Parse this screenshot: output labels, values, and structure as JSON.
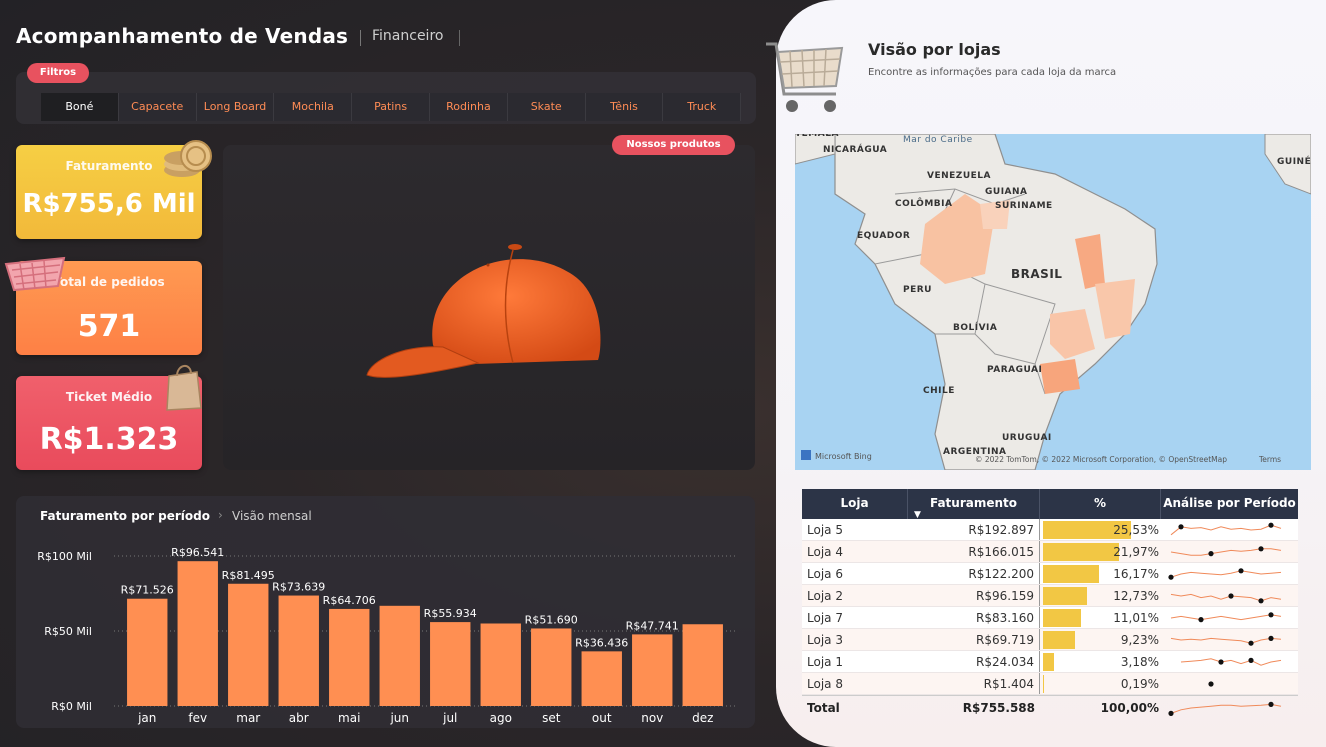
{
  "header": {
    "title": "Acompanhamento de Vendas",
    "subtitle": "Financeiro"
  },
  "filters": {
    "label": "Filtros",
    "tabs": [
      "Boné",
      "Capacete",
      "Long Board",
      "Mochila",
      "Patins",
      "Rodinha",
      "Skate",
      "Tênis",
      "Truck"
    ],
    "active": 0
  },
  "kpis": {
    "faturamento": {
      "label": "Faturamento",
      "value": "R$755,6 Mil"
    },
    "pedidos": {
      "label": "Total de pedidos",
      "value": "571"
    },
    "ticket": {
      "label": "Ticket Médio",
      "value": "R$1.323"
    }
  },
  "product": {
    "badge": "Nossos produtos",
    "icon": "orange-cap"
  },
  "chart_section": {
    "title": "Faturamento por período",
    "subtitle": "Visão mensal"
  },
  "chart_data": {
    "type": "bar",
    "categories": [
      "jan",
      "fev",
      "mar",
      "abr",
      "mai",
      "jun",
      "jul",
      "ago",
      "set",
      "out",
      "nov",
      "dez"
    ],
    "values": [
      71526,
      96541,
      81495,
      73639,
      64706,
      66800,
      55934,
      55000,
      51690,
      36436,
      47741,
      54500
    ],
    "labels": [
      "R$71.526",
      "R$96.541",
      "R$81.495",
      "R$73.639",
      "R$64.706",
      "",
      "R$55.934",
      "",
      "R$51.690",
      "R$36.436",
      "R$47.741",
      ""
    ],
    "ylim": [
      0,
      100000
    ],
    "yticks": [
      {
        "v": 0,
        "t": "R$0 Mil"
      },
      {
        "v": 50000,
        "t": "R$50 Mil"
      },
      {
        "v": 100000,
        "t": "R$100 Mil"
      }
    ],
    "color": "#ff8f52"
  },
  "stores": {
    "title": "Visão por lojas",
    "subtitle": "Encontre as informações para cada loja da marca",
    "map": {
      "labels": [
        "NICARÁGUA",
        "Mar do Caribe",
        "VENEZUELA",
        "GUIANA",
        "SURINAME",
        "COLÔMBIA",
        "EQUADOR",
        "BRASIL",
        "PERU",
        "BOLÍVIA",
        "PARAGUAI",
        "CHILE",
        "URUGUAI",
        "ARGENTINA",
        "GUINÉ",
        "TEMALA"
      ],
      "attribution": "© 2022 TomTom, © 2022 Microsoft Corporation, © OpenStreetMap",
      "terms": "Terms",
      "logo": "Microsoft Bing"
    },
    "table": {
      "headers": [
        "Loja",
        "Faturamento",
        "%",
        "Análise por Período"
      ],
      "rows": [
        {
          "loja": "Loja 5",
          "fat": "R$192.897",
          "pct": "25,53%",
          "p": 25.53,
          "spark": [
            0.2,
            0.7,
            0.6,
            0.65,
            0.5,
            0.7,
            0.55,
            0.6,
            0.5,
            0.55,
            0.8,
            0.6
          ],
          "dot": [
            1,
            10
          ]
        },
        {
          "loja": "Loja 4",
          "fat": "R$166.015",
          "pct": "21,97%",
          "p": 21.97,
          "spark": [
            0.5,
            0.4,
            0.3,
            0.3,
            0.4,
            0.5,
            0.6,
            0.55,
            0.6,
            0.7,
            0.7,
            0.6
          ],
          "dot": [
            4,
            9
          ]
        },
        {
          "loja": "Loja 6",
          "fat": "R$122.200",
          "pct": "16,17%",
          "p": 16.17,
          "spark": [
            0.3,
            0.5,
            0.6,
            0.55,
            0.5,
            0.45,
            0.55,
            0.7,
            0.6,
            0.5,
            0.55,
            0.6
          ],
          "dot": [
            0,
            7
          ]
        },
        {
          "loja": "Loja 2",
          "fat": "R$96.159",
          "pct": "12,73%",
          "p": 12.73,
          "spark": [
            0.6,
            0.5,
            0.6,
            0.4,
            0.5,
            0.3,
            0.5,
            0.45,
            0.4,
            0.2,
            0.4,
            0.3
          ],
          "dot": [
            6,
            9
          ]
        },
        {
          "loja": "Loja 7",
          "fat": "R$83.160",
          "pct": "11,01%",
          "p": 11.01,
          "spark": [
            0.5,
            0.6,
            0.5,
            0.4,
            0.5,
            0.6,
            0.5,
            0.4,
            0.5,
            0.6,
            0.7,
            0.6
          ],
          "dot": [
            3,
            10
          ]
        },
        {
          "loja": "Loja 3",
          "fat": "R$69.719",
          "pct": "9,23%",
          "p": 9.23,
          "spark": [
            0.6,
            0.5,
            0.55,
            0.5,
            0.6,
            0.55,
            0.5,
            0.45,
            0.3,
            0.5,
            0.6,
            0.55
          ],
          "dot": [
            8,
            10
          ]
        },
        {
          "loja": "Loja 1",
          "fat": "R$24.034",
          "pct": "3,18%",
          "p": 3.18,
          "spark": [
            null,
            0.5,
            0.55,
            0.6,
            0.7,
            0.5,
            0.6,
            0.4,
            0.6,
            0.3,
            0.5,
            0.6
          ],
          "dot": [
            5,
            8
          ]
        },
        {
          "loja": "Loja 8",
          "fat": "R$1.404",
          "pct": "0,19%",
          "p": 0.19,
          "spark": [
            null,
            null,
            null,
            null,
            0.5,
            null,
            null,
            null,
            null,
            null,
            null,
            null
          ],
          "dot": [
            4
          ]
        }
      ],
      "total": {
        "label": "Total",
        "fat": "R$755.588",
        "pct": "100,00%",
        "spark": [
          0.2,
          0.4,
          0.5,
          0.55,
          0.6,
          0.65,
          0.65,
          0.6,
          0.62,
          0.65,
          0.7,
          0.6
        ],
        "dot": [
          0,
          10
        ]
      }
    }
  }
}
